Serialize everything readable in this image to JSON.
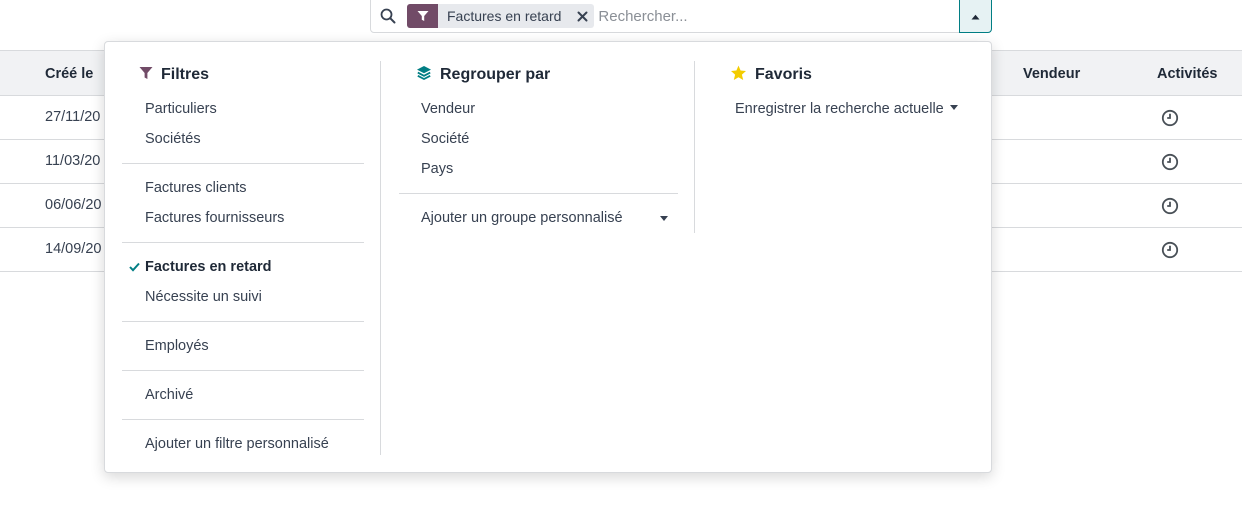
{
  "search": {
    "facet_label": "Factures en retard",
    "placeholder": "Rechercher...",
    "icons": {
      "search": "search-icon",
      "facet": "funnel-icon",
      "close": "close-icon",
      "toggle": "caret-up-icon"
    }
  },
  "table": {
    "headers": {
      "created": "Créé le",
      "salesperson": "Vendeur",
      "activities": "Activités"
    },
    "rows": [
      {
        "date": "27/11/20"
      },
      {
        "date": "11/03/20"
      },
      {
        "date": "06/06/20"
      },
      {
        "date": "14/09/20"
      }
    ]
  },
  "filters": {
    "title": "Filtres",
    "groups": [
      [
        "Particuliers",
        "Sociétés"
      ],
      [
        "Factures clients",
        "Factures fournisseurs"
      ],
      [
        "Factures en retard",
        "Nécessite un suivi"
      ],
      [
        "Employés"
      ],
      [
        "Archivé"
      ],
      [
        "Ajouter un filtre personnalisé"
      ]
    ],
    "selected": "Factures en retard"
  },
  "group_by": {
    "title": "Regrouper par",
    "items": [
      "Vendeur",
      "Société",
      "Pays"
    ],
    "custom": "Ajouter un groupe personnalisé"
  },
  "favorites": {
    "title": "Favoris",
    "save_current": "Enregistrer la recherche actuelle"
  },
  "colors": {
    "brand": "#714b67",
    "teal": "#017e84",
    "star": "#f3cc00",
    "check": "#017e84"
  }
}
